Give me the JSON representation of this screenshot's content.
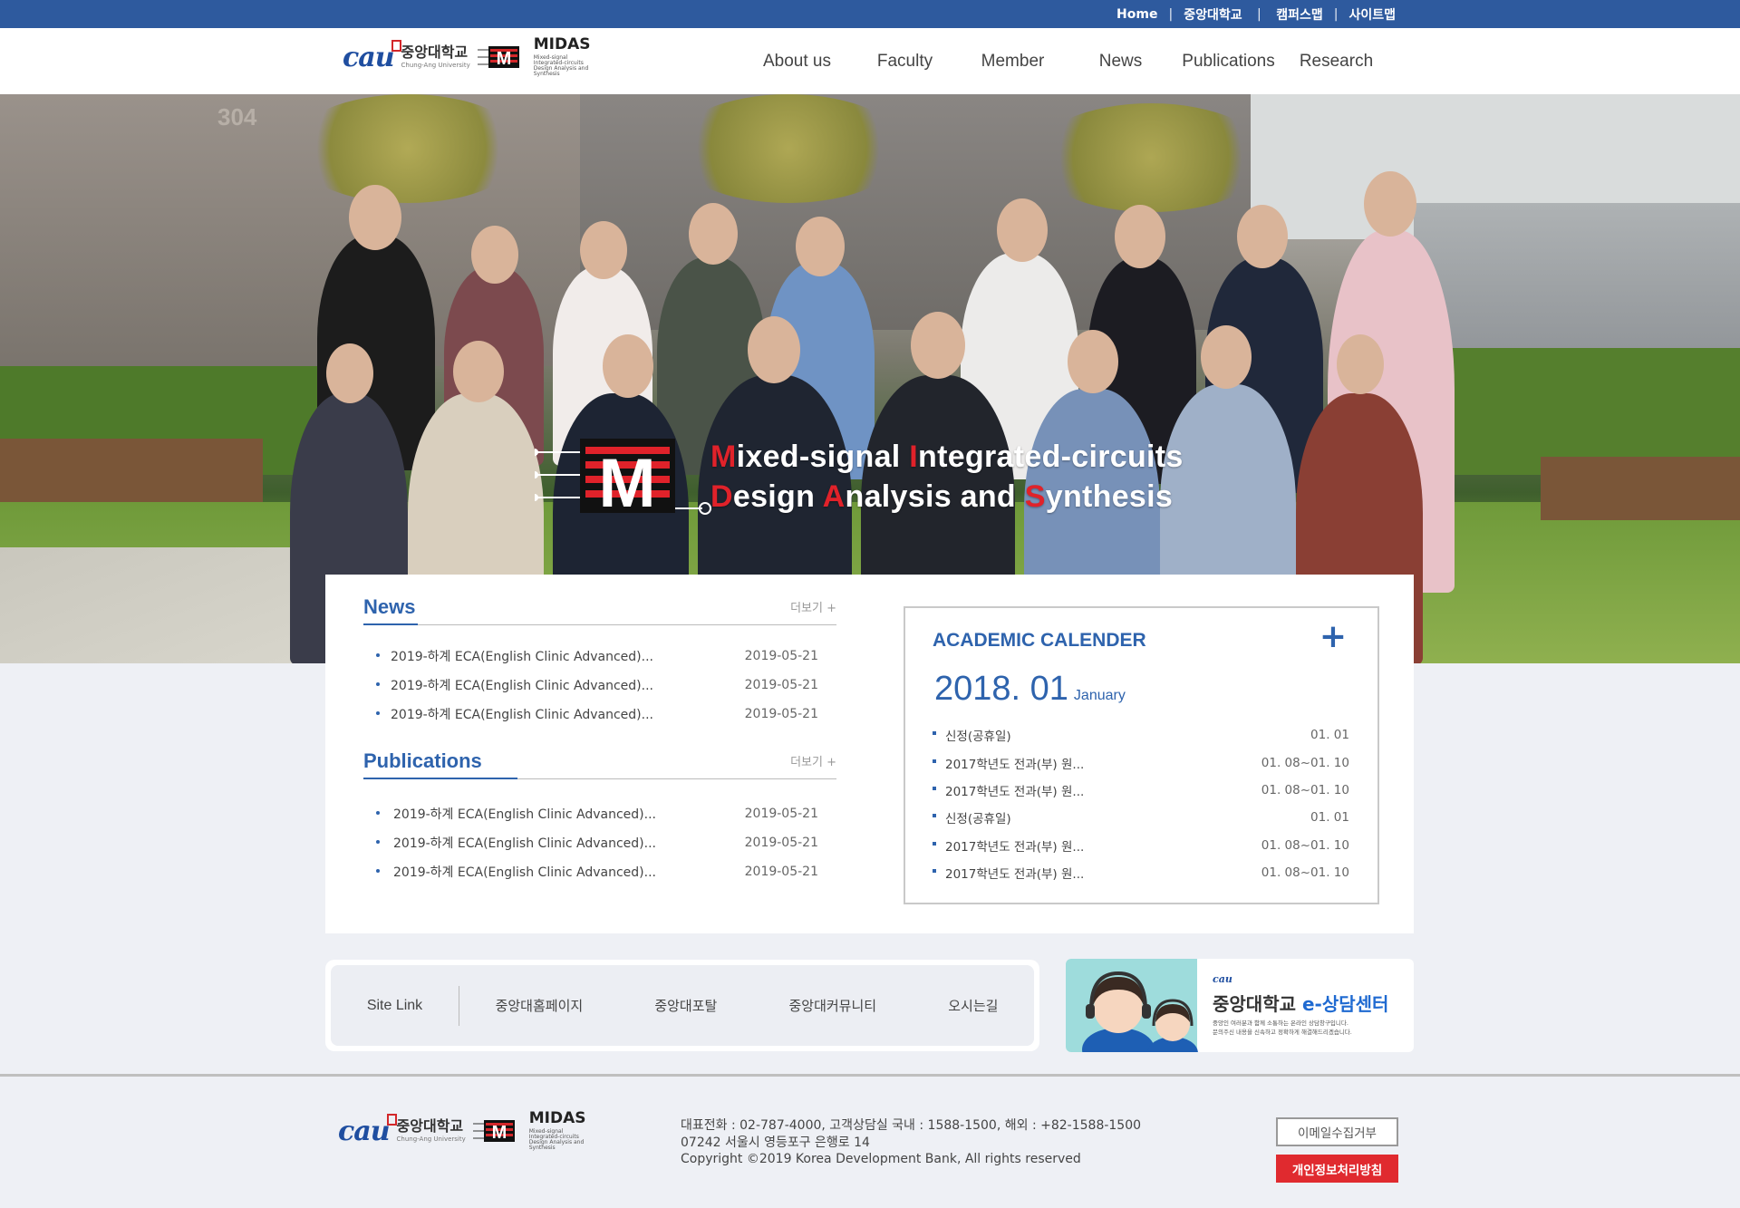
{
  "topbar": {
    "links": [
      "Home",
      "중앙대학교",
      "캠퍼스맵",
      "사이트맵"
    ]
  },
  "logo": {
    "cau": "CAU",
    "university_ko": "중앙대학교",
    "university_en": "Chung-Ang University",
    "lab": "MIDAS",
    "lab_sub": "Mixed-signal Integrated-circuits Design Analysis and Synthesis"
  },
  "nav": [
    "About us",
    "Faculty",
    "Member",
    "News",
    "Publications",
    "Research"
  ],
  "hero": {
    "building_number": "304",
    "line1": [
      {
        "text": "M",
        "red": true
      },
      {
        "text": "ixed-signal ",
        "red": false
      },
      {
        "text": "I",
        "red": true
      },
      {
        "text": "ntegrated-circuits",
        "red": false
      }
    ],
    "line2": [
      {
        "text": "D",
        "red": true
      },
      {
        "text": "esign ",
        "red": false
      },
      {
        "text": "A",
        "red": true
      },
      {
        "text": "nalysis and ",
        "red": false
      },
      {
        "text": "S",
        "red": true
      },
      {
        "text": "ynthesis",
        "red": false
      }
    ]
  },
  "news": {
    "title": "News",
    "more": "더보기 +",
    "items": [
      {
        "title": "2019-하계 ECA(English Clinic Advanced)...",
        "date": "2019-05-21"
      },
      {
        "title": "2019-하계 ECA(English Clinic Advanced)...",
        "date": "2019-05-21"
      },
      {
        "title": "2019-하계 ECA(English Clinic Advanced)...",
        "date": "2019-05-21"
      }
    ]
  },
  "publications": {
    "title": "Publications",
    "more": "더보기 +",
    "items": [
      {
        "title": "2019-하계 ECA(English Clinic Advanced)...",
        "date": "2019-05-21"
      },
      {
        "title": "2019-하계 ECA(English Clinic Advanced)...",
        "date": "2019-05-21"
      },
      {
        "title": "2019-하계 ECA(English Clinic Advanced)...",
        "date": "2019-05-21"
      }
    ]
  },
  "calendar": {
    "title": "ACADEMIC CALENDER",
    "plus": "+",
    "year_month": "2018. 01",
    "month_name": "January",
    "items": [
      {
        "title": "신정(공휴일)",
        "date": "01. 01"
      },
      {
        "title": "2017학년도 전과(부) 원...",
        "date": "01. 08~01. 10"
      },
      {
        "title": "2017학년도 전과(부) 원...",
        "date": "01. 08~01. 10"
      },
      {
        "title": "신정(공휴일)",
        "date": "01. 01"
      },
      {
        "title": "2017학년도 전과(부) 원...",
        "date": "01. 08~01. 10"
      },
      {
        "title": "2017학년도 전과(부) 원...",
        "date": "01. 08~01. 10"
      }
    ]
  },
  "sitelink": {
    "label": "Site Link",
    "links": [
      "중앙대홈페이지",
      "중앙대포탈",
      "중앙대커뮤니티",
      "오시는길"
    ]
  },
  "counsel": {
    "cau": "CAU",
    "title_ko": "중앙대학교",
    "title_blue": "e-상담센터",
    "desc1": "중앙인 여러분과 함께 소통하는 온라인 상담창구입니다.",
    "desc2": "문의주신 내용을 신속하고 정확하게 해결해드리겠습니다."
  },
  "footer": {
    "line1": "대표전화 : 02-787-4000, 고객상담실 국내 : 1588-1500, 해외 : +82-1588-1500",
    "line2": "07242 서울시 영등포구 은행로 14",
    "line3": "Copyright ©2019 Korea Development Bank, All rights reserved",
    "btn_email": "이메일수집거부",
    "btn_privacy": "개인정보처리방침"
  },
  "colors": {
    "brand_blue": "#2e5a9e",
    "accent_blue": "#2e63ad",
    "accent_red": "#e0222a"
  }
}
